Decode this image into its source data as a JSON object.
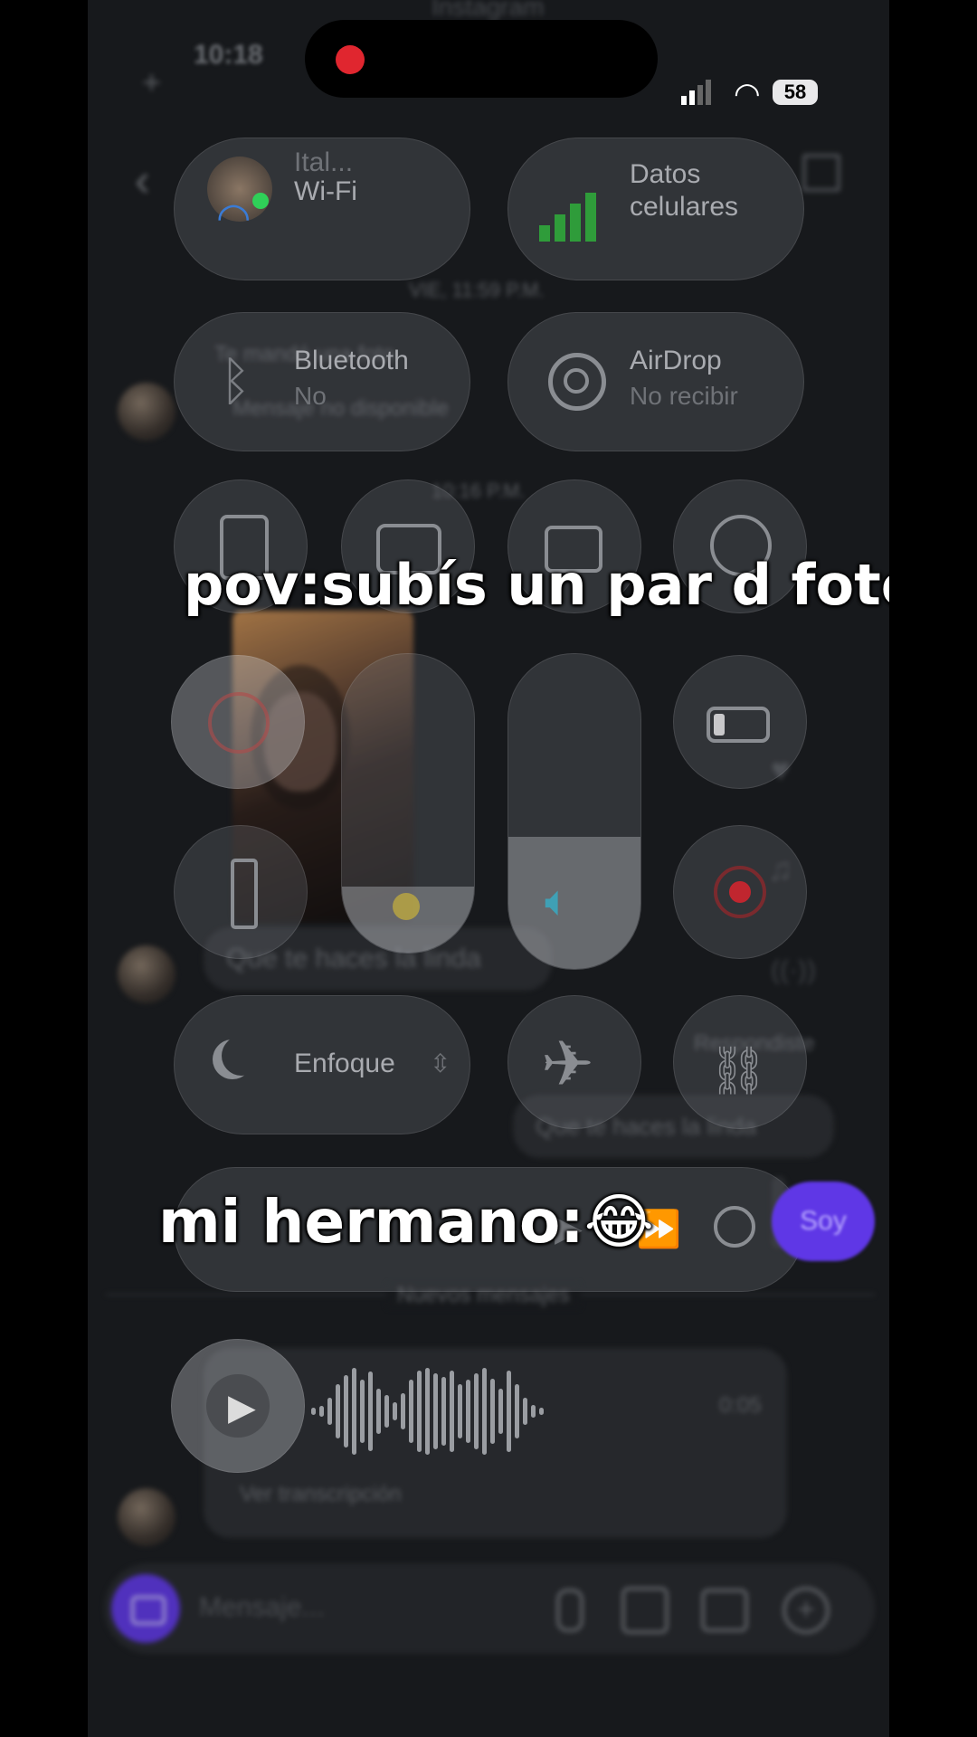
{
  "app": {
    "name": "Instagram"
  },
  "status_bar": {
    "time": "10:18",
    "battery": "58"
  },
  "chat": {
    "date_1": "VIE, 11:59 P.M.",
    "msg_1": "Te mandé una foto",
    "msg_1b": "Mensaje no disponible",
    "date_2": "10:16 P.M.",
    "msg_2": "Que te haces la linda",
    "reply_label": "Respondiste",
    "reply_quote": "Que te haces la linda",
    "sent_msg": "Soy",
    "divider": "Nuevos mensajes",
    "voice_duration": "0:05",
    "voice_transcript": "Ver transcripción",
    "composer_placeholder": "Mensaje..."
  },
  "control_center": {
    "wifi": {
      "title": "Wi-Fi",
      "network": "Ital..."
    },
    "cellular": {
      "title": "Datos celulares"
    },
    "bluetooth": {
      "title": "Bluetooth",
      "status": "No"
    },
    "airdrop": {
      "title": "AirDrop",
      "status": "No recibir"
    },
    "focus": {
      "label": "Enfoque"
    },
    "volume_level": 0.42,
    "brightness_level": 0.22
  },
  "overlay": {
    "caption_top": "pov:subís un par d fotos",
    "caption_bottom": "mi hermano:😂"
  },
  "colors": {
    "accent_purple": "#6b3cf5",
    "record_red": "#e0262f",
    "cell_green": "#2f9c3a"
  }
}
